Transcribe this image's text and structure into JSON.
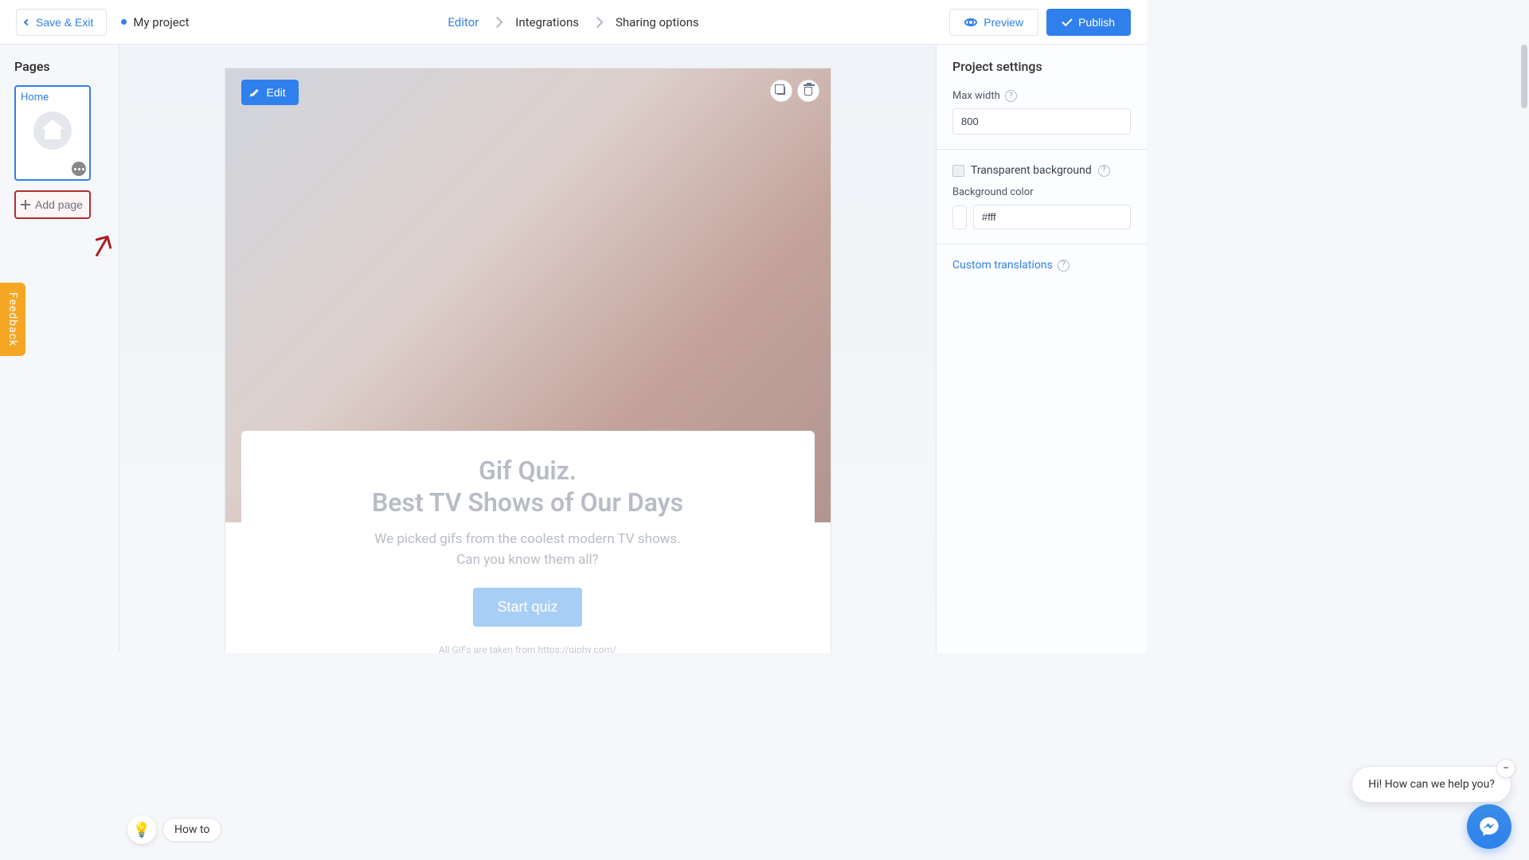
{
  "topbar": {
    "save_exit": "Save & Exit",
    "project_name": "My project",
    "steps": {
      "editor": "Editor",
      "integrations": "Integrations",
      "sharing": "Sharing options"
    },
    "preview": "Preview",
    "publish": "Publish"
  },
  "left": {
    "heading": "Pages",
    "home_label": "Home",
    "add_page": "Add page"
  },
  "canvas": {
    "edit": "Edit",
    "title_line1": "Gif Quiz.",
    "title_line2": "Best TV Shows of Our Days",
    "desc_line1": "We picked gifs from the coolest modern TV shows.",
    "desc_line2": "Can you know them all?",
    "start": "Start quiz",
    "footnote": "All GIFs are taken from https://giphy.com/"
  },
  "right": {
    "heading": "Project settings",
    "max_width_label": "Max width",
    "max_width_value": "800",
    "transparent_bg_label": "Transparent background",
    "bg_color_label": "Background color",
    "bg_color_value": "#fff",
    "custom_translations": "Custom translations"
  },
  "feedback_tab": "Feedback",
  "howto": "How to",
  "chat": {
    "message": "Hi! How can we help you?"
  }
}
